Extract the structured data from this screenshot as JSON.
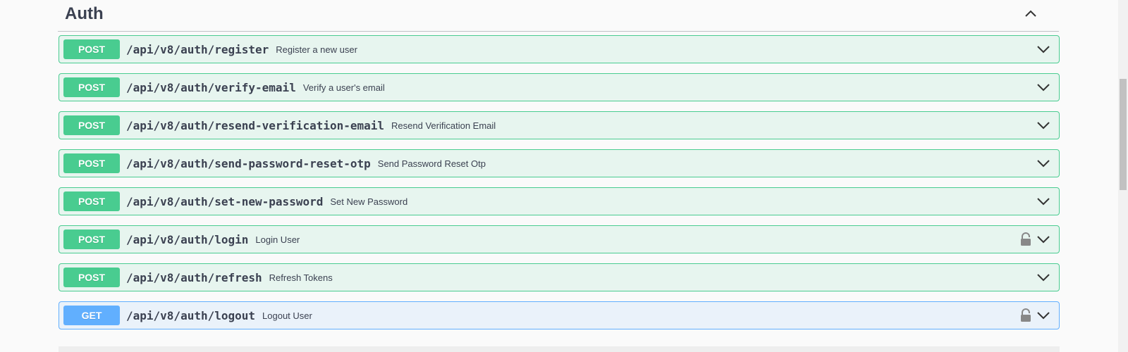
{
  "section": {
    "title": "Auth",
    "toggle_icon": "chevron-up-icon"
  },
  "operations": [
    {
      "method": "POST",
      "path": "/api/v8/auth/register",
      "summary": "Register a new user",
      "locked": false
    },
    {
      "method": "POST",
      "path": "/api/v8/auth/verify-email",
      "summary": "Verify a user's email",
      "locked": false
    },
    {
      "method": "POST",
      "path": "/api/v8/auth/resend-verification-email",
      "summary": "Resend Verification Email",
      "locked": false
    },
    {
      "method": "POST",
      "path": "/api/v8/auth/send-password-reset-otp",
      "summary": "Send Password Reset Otp",
      "locked": false
    },
    {
      "method": "POST",
      "path": "/api/v8/auth/set-new-password",
      "summary": "Set New Password",
      "locked": false
    },
    {
      "method": "POST",
      "path": "/api/v8/auth/login",
      "summary": "Login User",
      "locked": true
    },
    {
      "method": "POST",
      "path": "/api/v8/auth/refresh",
      "summary": "Refresh Tokens",
      "locked": false
    },
    {
      "method": "GET",
      "path": "/api/v8/auth/logout",
      "summary": "Logout User",
      "locked": true
    }
  ],
  "colors": {
    "post": "#49cc90",
    "get": "#61affe",
    "text": "#3b4151"
  },
  "icons": {
    "expand": "chevron-down-icon",
    "lock": "lock-icon"
  }
}
